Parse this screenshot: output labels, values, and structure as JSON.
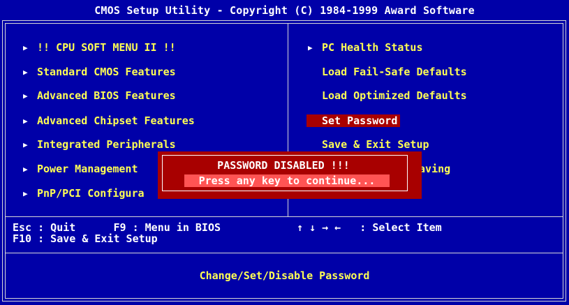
{
  "header": {
    "title": "CMOS Setup Utility - Copyright (C) 1984-1999 Award Software"
  },
  "left_menu": [
    {
      "label": "!! CPU SOFT MENU II !!",
      "arrow": "▶"
    },
    {
      "label": "Standard CMOS Features",
      "arrow": "▶"
    },
    {
      "label": "Advanced BIOS Features",
      "arrow": "▶"
    },
    {
      "label": "Advanced Chipset Features",
      "arrow": "▶"
    },
    {
      "label": "Integrated Peripherals",
      "arrow": "▶"
    },
    {
      "label": "Power Management",
      "arrow": "▶"
    },
    {
      "label": "PnP/PCI Configura",
      "arrow": "▶"
    }
  ],
  "right_menu": [
    {
      "label": "PC Health Status",
      "arrow": "▶"
    },
    {
      "label": "Load Fail-Safe Defaults"
    },
    {
      "label": "Load Optimized Defaults"
    },
    {
      "label": "Set Password"
    },
    {
      "label": "Save & Exit Setup"
    },
    {
      "label": "Saving"
    }
  ],
  "dialog": {
    "title": "PASSWORD DISABLED !!!",
    "message": "Press any key to continue..."
  },
  "help": {
    "line1_left": "Esc : Quit      F9 : Menu in BIOS",
    "line2_left": "F10 : Save & Exit Setup",
    "line1_right": "↑ ↓ → ←   : Select Item"
  },
  "status": {
    "text": "Change/Set/Disable Password"
  },
  "colors": {
    "background": "#0000a8",
    "menu_text": "#ffff54",
    "selection": "#a80000",
    "dialog_highlight": "#ff5454"
  }
}
